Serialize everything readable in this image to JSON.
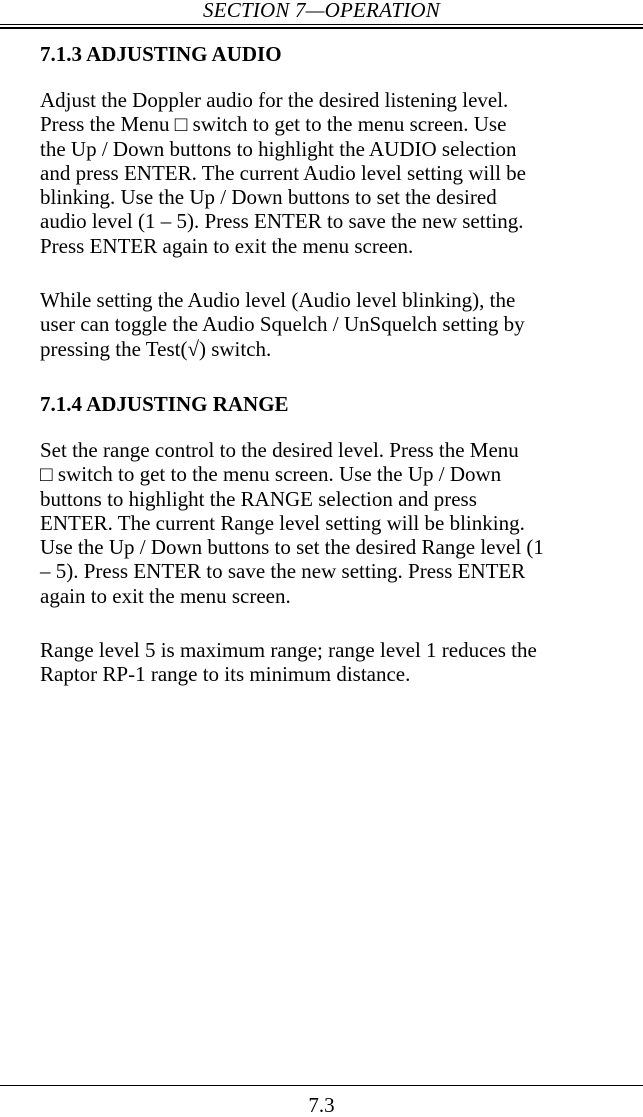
{
  "header": {
    "section_title": "SECTION 7—OPERATION"
  },
  "sections": [
    {
      "heading": "7.1.3 ADJUSTING AUDIO",
      "paragraphs": [
        "Adjust the Doppler audio for the desired listening level.\nPress the Menu □ switch to get to the menu screen.  Use\nthe Up / Down buttons to highlight the AUDIO selection\nand press ENTER.  The current Audio level setting will be\nblinking. Use the Up / Down buttons to set the desired\naudio level (1 – 5).  Press ENTER to save the new setting.\nPress ENTER again to exit the menu screen.",
        "While setting the Audio level (Audio level blinking), the\nuser can toggle the Audio Squelch / UnSquelch setting by\npressing the Test(√) switch."
      ]
    },
    {
      "heading": "7.1.4 ADJUSTING RANGE",
      "paragraphs": [
        "Set the range control to the desired level.  Press the Menu\n□ switch to get to the menu screen.  Use the Up / Down\nbuttons to highlight the RANGE selection and press\nENTER.  The current Range level setting will be blinking.\nUse the Up / Down buttons to set the desired Range level (1\n– 5).  Press ENTER to save the new setting.  Press ENTER\nagain to exit the menu screen.",
        " Range level 5 is maximum range; range level 1 reduces the\nRaptor RP-1 range to its minimum distance."
      ]
    }
  ],
  "footer": {
    "page_number": "7.3"
  }
}
